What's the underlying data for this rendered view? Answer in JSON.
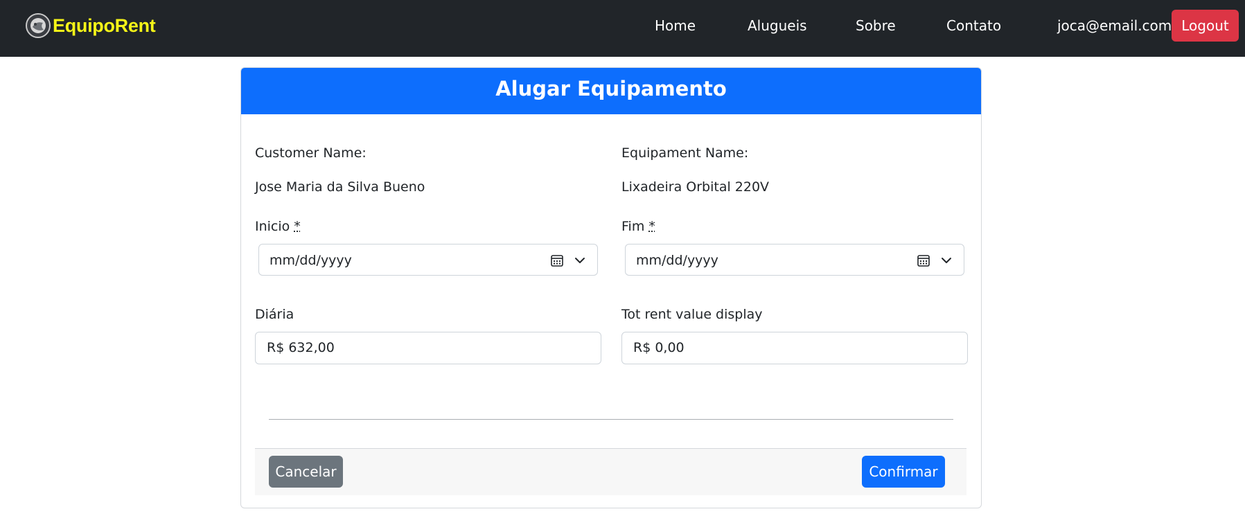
{
  "navbar": {
    "brand": "EquipoRent",
    "links": [
      "Home",
      "Alugueis",
      "Sobre",
      "Contato"
    ],
    "user_email": "joca@email.com",
    "logout_label": "Logout"
  },
  "form": {
    "title": "Alugar Equipamento",
    "customer_label": "Customer Name:",
    "customer_value": "Jose Maria da Silva Bueno",
    "equipment_label": "Equipament Name:",
    "equipment_value": "Lixadeira Orbital 220V",
    "inicio_label": "Inicio",
    "fim_label": "Fim",
    "required_mark": "*",
    "date_placeholder": "mm/dd/yyyy",
    "diaria_label": "Diária",
    "diaria_value": "R$ 632,00",
    "total_label": "Tot rent value display",
    "total_value": "R$ 0,00",
    "cancel_label": "Cancelar",
    "confirm_label": "Confirmar"
  },
  "icons": {
    "logo": "brand-logo-icon",
    "calendar": "calendar-icon",
    "dropdown": "chevron-down-icon"
  },
  "colors": {
    "navbar_bg": "#212529",
    "brand": "#f5f518",
    "primary": "#0d6efd",
    "danger": "#dc3545",
    "secondary": "#6c757d"
  }
}
